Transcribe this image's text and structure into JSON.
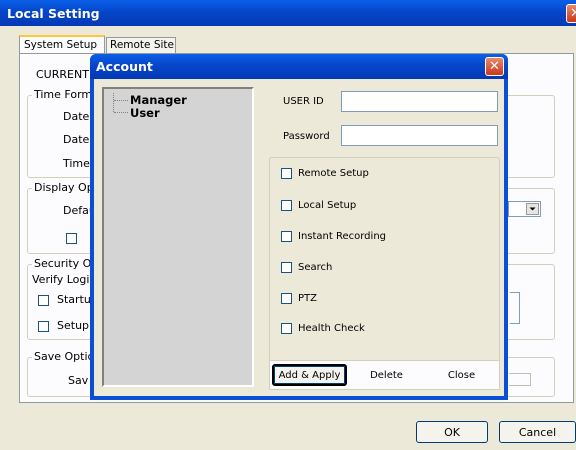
{
  "main_window": {
    "title": "Local Setting",
    "close_glyph": "✕",
    "tabs": [
      {
        "label": "System Setup"
      },
      {
        "label": "Remote Site"
      }
    ],
    "bg_labels": {
      "current": "CURRENT",
      "time_format": "Time Form",
      "date1": "Date",
      "date2": "Date",
      "time": "Time",
      "display_options": "Display Op",
      "default": "Defau",
      "security": "Security O",
      "verify_login": "Verify Logi",
      "startup": "Startu",
      "setup": "Setup",
      "save_options": "Save Optic",
      "save": "Sav"
    },
    "ok_label": "OK",
    "cancel_label": "Cancel"
  },
  "dialog": {
    "title": "Account",
    "close_glyph": "✕",
    "tree": [
      {
        "label": "Manager"
      },
      {
        "label": "User"
      }
    ],
    "user_id_label": "USER ID",
    "user_id_value": "",
    "password_label": "Password",
    "password_value": "",
    "permissions": [
      {
        "label": "Remote Setup",
        "checked": false
      },
      {
        "label": "Local Setup",
        "checked": false
      },
      {
        "label": "Instant Recording",
        "checked": false
      },
      {
        "label": "Search",
        "checked": false
      },
      {
        "label": "PTZ",
        "checked": false
      },
      {
        "label": "Health Check",
        "checked": false
      }
    ],
    "buttons": {
      "add_apply": "Add & Apply",
      "delete": "Delete",
      "close": "Close"
    }
  }
}
